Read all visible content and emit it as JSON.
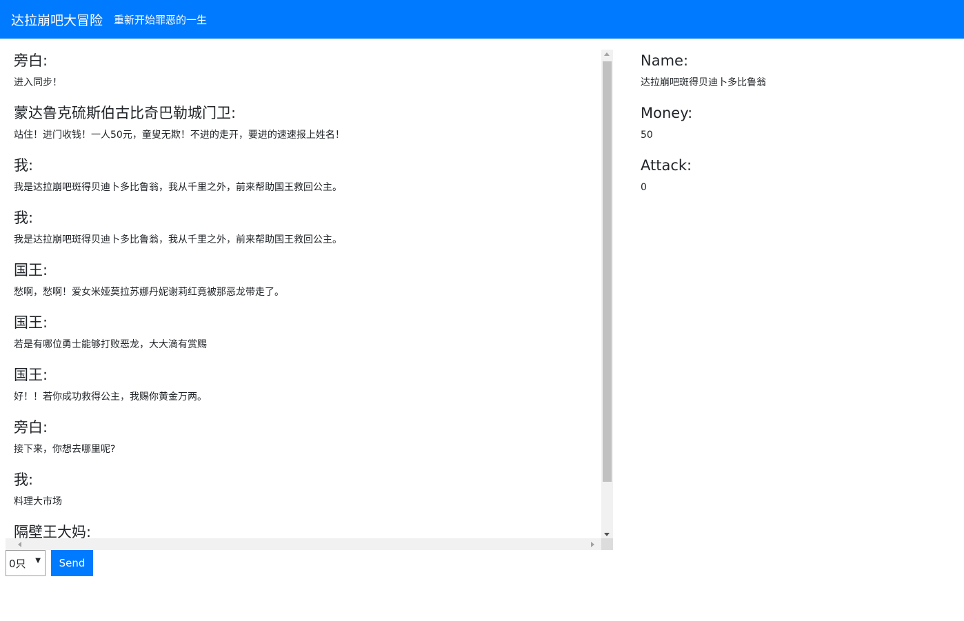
{
  "header": {
    "brand": "达拉崩吧大冒险",
    "restart": "重新开始罪恶的一生"
  },
  "messages": [
    {
      "speaker": "旁白:",
      "text": "进入同步！"
    },
    {
      "speaker": "蒙达鲁克硫斯伯古比奇巴勒城门卫:",
      "text": "站住！进门收钱！一人50元，童叟无欺！不进的走开，要进的速速报上姓名！"
    },
    {
      "speaker": "我:",
      "text": "我是达拉崩吧斑得贝迪卜多比鲁翁，我从千里之外，前来帮助国王救回公主。"
    },
    {
      "speaker": "我:",
      "text": "我是达拉崩吧斑得贝迪卜多比鲁翁，我从千里之外，前来帮助国王救回公主。"
    },
    {
      "speaker": "国王:",
      "text": "愁啊，愁啊！爱女米娅莫拉苏娜丹妮谢莉红竟被那恶龙带走了。"
    },
    {
      "speaker": "国王:",
      "text": "若是有哪位勇士能够打败恶龙，大大滴有赏赐"
    },
    {
      "speaker": "国王:",
      "text": "好！！若你成功救得公主，我赐你黄金万两。"
    },
    {
      "speaker": "旁白:",
      "text": "接下来，你想去哪里呢?"
    },
    {
      "speaker": "我:",
      "text": "料理大市场"
    },
    {
      "speaker": "隔壁王大妈:",
      "text": ""
    }
  ],
  "controls": {
    "select_value": "0只",
    "send_label": "Send"
  },
  "stats": {
    "name_label": "Name:",
    "name_value": "达拉崩吧斑得贝迪卜多比鲁翁",
    "money_label": "Money:",
    "money_value": "50",
    "attack_label": "Attack:",
    "attack_value": "0"
  },
  "colors": {
    "primary": "#007bff"
  }
}
